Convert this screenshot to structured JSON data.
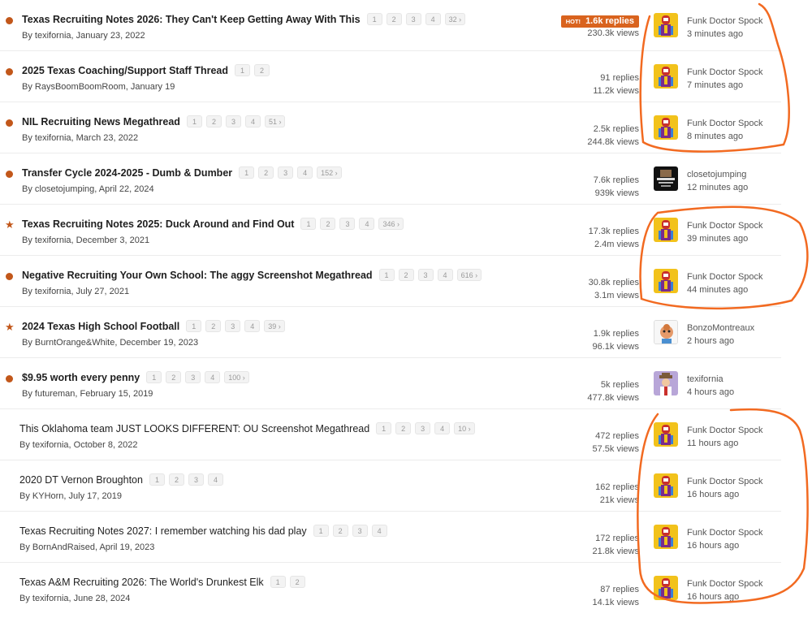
{
  "threads": [
    {
      "title": "Texas Recruiting Notes 2026: They Can't Keep Getting Away With This",
      "pages": [
        "1",
        "2",
        "3",
        "4",
        "32 ›"
      ],
      "author": "By texifornia, January 23, 2022",
      "hot_tag": "HOT!",
      "replies": "1.6k replies",
      "views": "230.3k views",
      "last_user": "Funk Doctor Spock",
      "last_time": "3 minutes ago"
    },
    {
      "title": "2025 Texas Coaching/Support Staff Thread",
      "pages": [
        "1",
        "2"
      ],
      "author": "By RaysBoomBoomRoom, January 19",
      "replies": "91 replies",
      "views": "11.2k views",
      "last_user": "Funk Doctor Spock",
      "last_time": "7 minutes ago"
    },
    {
      "title": "NIL Recruiting News Megathread",
      "pages": [
        "1",
        "2",
        "3",
        "4",
        "51 ›"
      ],
      "author": "By texifornia, March 23, 2022",
      "replies": "2.5k replies",
      "views": "244.8k views",
      "last_user": "Funk Doctor Spock",
      "last_time": "8 minutes ago"
    },
    {
      "title": "Transfer Cycle 2024-2025 - Dumb & Dumber",
      "pages": [
        "1",
        "2",
        "3",
        "4",
        "152 ›"
      ],
      "author": "By closetojumping, April 22, 2024",
      "replies": "7.6k replies",
      "views": "939k views",
      "last_user": "closetojumping",
      "last_time": "12 minutes ago"
    },
    {
      "title": "Texas Recruiting Notes 2025: Duck Around and Find Out",
      "pages": [
        "1",
        "2",
        "3",
        "4",
        "346 ›"
      ],
      "author": "By texifornia, December 3, 2021",
      "replies": "17.3k replies",
      "views": "2.4m views",
      "last_user": "Funk Doctor Spock",
      "last_time": "39 minutes ago"
    },
    {
      "title": "Negative Recruiting Your Own School: The aggy Screenshot Megathread",
      "pages": [
        "1",
        "2",
        "3",
        "4",
        "616 ›"
      ],
      "author": "By texifornia, July 27, 2021",
      "replies": "30.8k replies",
      "views": "3.1m views",
      "last_user": "Funk Doctor Spock",
      "last_time": "44 minutes ago"
    },
    {
      "title": "2024 Texas High School Football",
      "pages": [
        "1",
        "2",
        "3",
        "4",
        "39 ›"
      ],
      "author": "By BurntOrange&White, December 19, 2023",
      "replies": "1.9k replies",
      "views": "96.1k views",
      "last_user": "BonzoMontreaux",
      "last_time": "2 hours ago"
    },
    {
      "title": "$9.95 worth every penny",
      "pages": [
        "1",
        "2",
        "3",
        "4",
        "100 ›"
      ],
      "author": "By futureman, February 15, 2019",
      "replies": "5k replies",
      "views": "477.8k views",
      "last_user": "texifornia",
      "last_time": "4 hours ago"
    },
    {
      "title": "This Oklahoma team JUST LOOKS DIFFERENT: OU Screenshot Megathread",
      "pages": [
        "1",
        "2",
        "3",
        "4",
        "10 ›"
      ],
      "author": "By texifornia, October 8, 2022",
      "replies": "472 replies",
      "views": "57.5k views",
      "last_user": "Funk Doctor Spock",
      "last_time": "11 hours ago"
    },
    {
      "title": "2020 DT Vernon Broughton",
      "pages": [
        "1",
        "2",
        "3",
        "4"
      ],
      "author": "By KYHorn, July 17, 2019",
      "replies": "162 replies",
      "views": "21k views",
      "last_user": "Funk Doctor Spock",
      "last_time": "16 hours ago"
    },
    {
      "title": "Texas Recruiting Notes 2027: I remember watching his dad play",
      "pages": [
        "1",
        "2",
        "3",
        "4"
      ],
      "author": "By BornAndRaised, April 19, 2023",
      "replies": "172 replies",
      "views": "21.8k views",
      "last_user": "Funk Doctor Spock",
      "last_time": "16 hours ago"
    },
    {
      "title": "Texas A&M Recruiting 2026: The World's Drunkest Elk",
      "pages": [
        "1",
        "2"
      ],
      "author": "By texifornia, June 28, 2024",
      "replies": "87 replies",
      "views": "14.1k views",
      "last_user": "Funk Doctor Spock",
      "last_time": "16 hours ago"
    }
  ],
  "colors": {
    "accent": "#c2571a",
    "hot": "#d9631e",
    "annotation": "#f26a21"
  }
}
